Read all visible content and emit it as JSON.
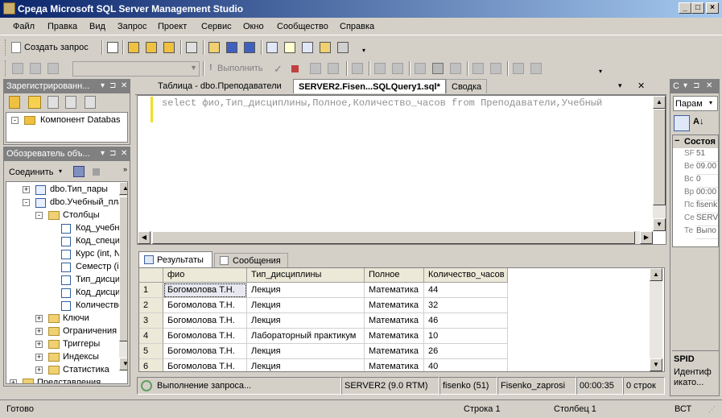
{
  "window": {
    "title": "Среда Microsoft SQL Server Management Studio"
  },
  "menu": [
    "Файл",
    "Правка",
    "Вид",
    "Запрос",
    "Проект",
    "Сервис",
    "Окно",
    "Сообщество",
    "Справка"
  ],
  "toolbar1": {
    "new_query": "Создать запрос"
  },
  "toolbar2": {
    "db_select": "",
    "execute": "Выполнить"
  },
  "registered": {
    "title": "Зарегистрированн...",
    "item": "Компонент Databas"
  },
  "explorer": {
    "title": "Обозреватель объ...",
    "connect": "Соединить",
    "rows": [
      {
        "label": "dbo.Тип_пары",
        "indent": 1,
        "icon": "table",
        "exp": "+"
      },
      {
        "label": "dbo.Учебный_план",
        "indent": 1,
        "icon": "table",
        "exp": "-"
      },
      {
        "label": "Столбцы",
        "indent": 2,
        "icon": "folder",
        "exp": "-"
      },
      {
        "label": "Код_учебн",
        "indent": 3,
        "icon": "column",
        "exp": ""
      },
      {
        "label": "Код_специ",
        "indent": 3,
        "icon": "column",
        "exp": ""
      },
      {
        "label": "Курс (int, N",
        "indent": 3,
        "icon": "column",
        "exp": ""
      },
      {
        "label": "Семестр (ir",
        "indent": 3,
        "icon": "column",
        "exp": ""
      },
      {
        "label": "Тип_дисци",
        "indent": 3,
        "icon": "column",
        "exp": ""
      },
      {
        "label": "Код_дисци",
        "indent": 3,
        "icon": "column",
        "exp": ""
      },
      {
        "label": "Количество",
        "indent": 3,
        "icon": "column",
        "exp": ""
      },
      {
        "label": "Ключи",
        "indent": 2,
        "icon": "folder",
        "exp": "+"
      },
      {
        "label": "Ограничения",
        "indent": 2,
        "icon": "folder",
        "exp": "+"
      },
      {
        "label": "Триггеры",
        "indent": 2,
        "icon": "folder",
        "exp": "+"
      },
      {
        "label": "Индексы",
        "indent": 2,
        "icon": "folder",
        "exp": "+"
      },
      {
        "label": "Статистика",
        "indent": 2,
        "icon": "folder",
        "exp": "+"
      },
      {
        "label": "Представления",
        "indent": 0,
        "icon": "folder",
        "exp": "+"
      }
    ]
  },
  "tabs": [
    "Таблица - dbo.Преподаватели",
    "SERVER2.Fisen...SQLQuery1.sql*",
    "Сводка"
  ],
  "editor": {
    "sql": "select фио,Тип_дисциплины,Полное,Количество_часов from Преподаватели,Учебный"
  },
  "results": {
    "tab_results": "Результаты",
    "tab_messages": "Сообщения",
    "columns": [
      "фио",
      "Тип_дисциплины",
      "Полное",
      "Количество_часов"
    ],
    "rows": [
      [
        "1",
        "Богомолова Т.Н.",
        "Лекция",
        "Математика",
        "44"
      ],
      [
        "2",
        "Богомолова Т.Н.",
        "Лекция",
        "Математика",
        "32"
      ],
      [
        "3",
        "Богомолова Т.Н.",
        "Лекция",
        "Математика",
        "46"
      ],
      [
        "4",
        "Богомолова Т.Н.",
        "Лабораторный практикум",
        "Математика",
        "10"
      ],
      [
        "5",
        "Богомолова Т.Н.",
        "Лекция",
        "Математика",
        "26"
      ],
      [
        "6",
        "Богомолова Т.Н.",
        "Лекция",
        "Математика",
        "40"
      ]
    ]
  },
  "query_status": {
    "text": "Выполнение запроса...",
    "server": "SERVER2 (9.0 RTM)",
    "user": "fisenko (51)",
    "db": "Fisenko_zaprosi",
    "time": "00:00:35",
    "rows": "0 строк"
  },
  "properties": {
    "title": "С",
    "dropdown": "Парам",
    "category": "Состоя",
    "items": [
      [
        "SF",
        "51"
      ],
      [
        "Be",
        "09.00"
      ],
      [
        "Bc",
        "0"
      ],
      [
        "Bp",
        "00:00"
      ],
      [
        "Пс",
        "fisenk"
      ],
      [
        "Се",
        "SERVE"
      ],
      [
        "Те",
        "Выпо"
      ]
    ],
    "desc_title": "SPID",
    "desc_text": "Идентиф икато..."
  },
  "statusbar": {
    "ready": "Готово",
    "line": "Строка 1",
    "col": "Столбец 1",
    "mode": "ВСТ"
  }
}
